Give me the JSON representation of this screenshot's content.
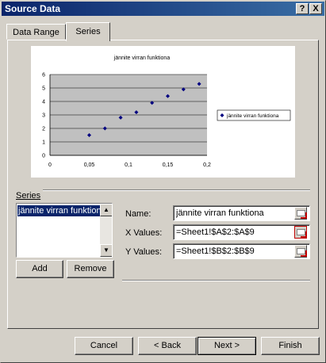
{
  "window": {
    "title": "Source Data",
    "help_button": "?",
    "close_button": "X"
  },
  "tabs": [
    {
      "label": "Data Range",
      "selected": false
    },
    {
      "label": "Series",
      "selected": true
    }
  ],
  "chart_data": {
    "type": "scatter",
    "title": "jännite virran funktiona",
    "xlabel": "",
    "ylabel": "",
    "xlim": [
      0,
      0.2
    ],
    "ylim": [
      0,
      6
    ],
    "xticks": [
      "0",
      "0,05",
      "0,1",
      "0,15",
      "0,2"
    ],
    "yticks": [
      "0",
      "1",
      "2",
      "3",
      "4",
      "5",
      "6"
    ],
    "grid": true,
    "legend": "right",
    "plot_background": "#c0c0c0",
    "marker_color": "#000080",
    "series": [
      {
        "name": "jännite virran funktiona",
        "x": [
          0.05,
          0.07,
          0.09,
          0.11,
          0.13,
          0.15,
          0.17,
          0.19
        ],
        "y": [
          1.5,
          2.0,
          2.8,
          3.2,
          3.9,
          4.4,
          4.9,
          5.3
        ]
      }
    ]
  },
  "series_section": {
    "group_label": "Series",
    "list_items": [
      "jännite virran funktiona"
    ],
    "add_button": "Add",
    "remove_button": "Remove",
    "name_label": "Name:",
    "name_value": "jännite virran funktiona",
    "x_label": "X Values:",
    "x_value": "=Sheet1!$A$2:$A$9",
    "y_label": "Y Values:",
    "y_value": "=Sheet1!$B$2:$B$9"
  },
  "footer": {
    "cancel": "Cancel",
    "back": "< Back",
    "next": "Next >",
    "finish": "Finish"
  }
}
